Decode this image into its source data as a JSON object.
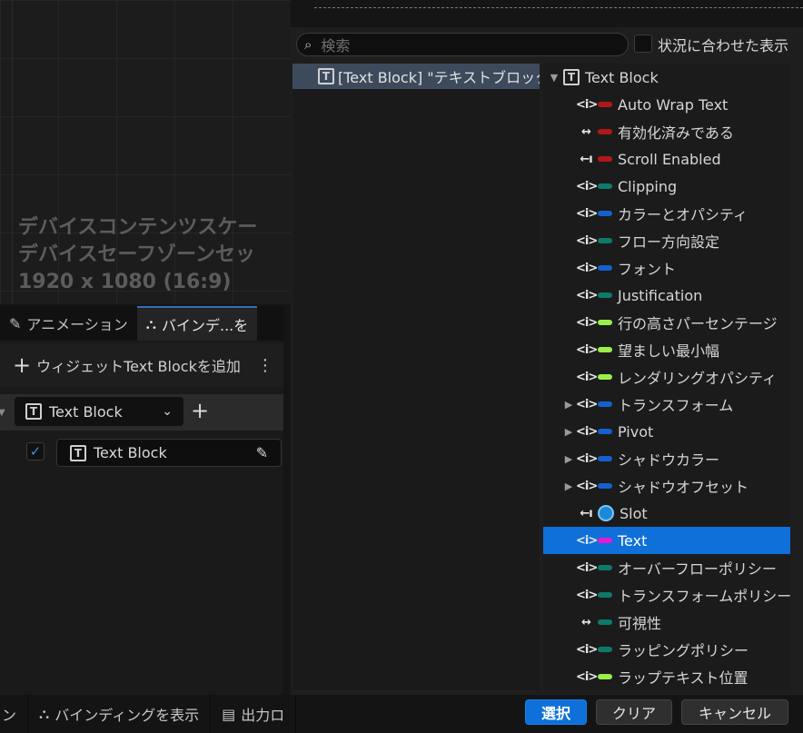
{
  "canvas": {
    "info_lines": [
      "デバイスコンテンツスケー",
      "デバイスセーフゾーンセッ",
      "1920 x 1080 (16:9)"
    ]
  },
  "left_panel": {
    "tabs": [
      {
        "label": "アニメーション",
        "icon": "pencil-icon"
      },
      {
        "label": "バインデ...を",
        "icon": "binding-icon"
      }
    ],
    "add_widget_label": "ウィジェットText Blockを追加",
    "combo_value": "Text Block",
    "checked_item": "Text Block"
  },
  "bottom_bar": {
    "tabs": [
      {
        "label": "ン"
      },
      {
        "label": "バインディングを表示",
        "icon": "binding-icon"
      },
      {
        "label": "出力ロ",
        "icon": "log-icon"
      }
    ]
  },
  "popup": {
    "search_placeholder": "検索",
    "context_label": "状況に合わせた表示",
    "left_item": "[Text Block] \"テキストブロック",
    "tree_root": "Text Block",
    "rows": [
      {
        "label": "Auto Wrap Text",
        "bind": "<i>",
        "color": "#b01818"
      },
      {
        "label": "有効化済みである",
        "bind": "↔",
        "color": "#b01818"
      },
      {
        "label": "Scroll Enabled",
        "bind": "←ı",
        "color": "#b01818"
      },
      {
        "label": "Clipping",
        "bind": "<i>",
        "color": "#0d7a6a"
      },
      {
        "label": "カラーとオパシティ",
        "bind": "<i>",
        "color": "#1460d0"
      },
      {
        "label": "フロー方向設定",
        "bind": "<i>",
        "color": "#0d7a6a"
      },
      {
        "label": "フォント",
        "bind": "<i>",
        "color": "#1460d0"
      },
      {
        "label": "Justification",
        "bind": "<i>",
        "color": "#0d7a6a"
      },
      {
        "label": "行の高さパーセンテージ",
        "bind": "<i>",
        "color": "#9af04a"
      },
      {
        "label": "望ましい最小幅",
        "bind": "<i>",
        "color": "#9af04a"
      },
      {
        "label": "レンダリングオパシティ",
        "bind": "<i>",
        "color": "#9af04a"
      },
      {
        "label": "トランスフォーム",
        "bind": "<i>",
        "color": "#1460d0",
        "expand": true
      },
      {
        "label": "Pivot",
        "bind": "<i>",
        "color": "#1460d0",
        "expand": true
      },
      {
        "label": "シャドウカラー",
        "bind": "<i>",
        "color": "#1460d0",
        "expand": true
      },
      {
        "label": "シャドウオフセット",
        "bind": "<i>",
        "color": "#1460d0",
        "expand": true
      },
      {
        "label": "Slot",
        "bind": "←ı",
        "slot": true
      },
      {
        "label": "Text",
        "bind": "<i>",
        "color": "#e81ad8",
        "selected": true
      },
      {
        "label": "オーバーフローポリシー",
        "bind": "<i>",
        "color": "#0d7a6a"
      },
      {
        "label": "トランスフォームポリシー",
        "bind": "<i>",
        "color": "#0d7a6a"
      },
      {
        "label": "可視性",
        "bind": "↔",
        "color": "#0d7a6a"
      },
      {
        "label": "ラッピングポリシー",
        "bind": "<i>",
        "color": "#0d7a6a"
      },
      {
        "label": "ラップテキスト位置",
        "bind": "<i>",
        "color": "#9af04a"
      }
    ],
    "buttons": {
      "select": "選択",
      "clear": "クリア",
      "cancel": "キャンセル"
    }
  }
}
